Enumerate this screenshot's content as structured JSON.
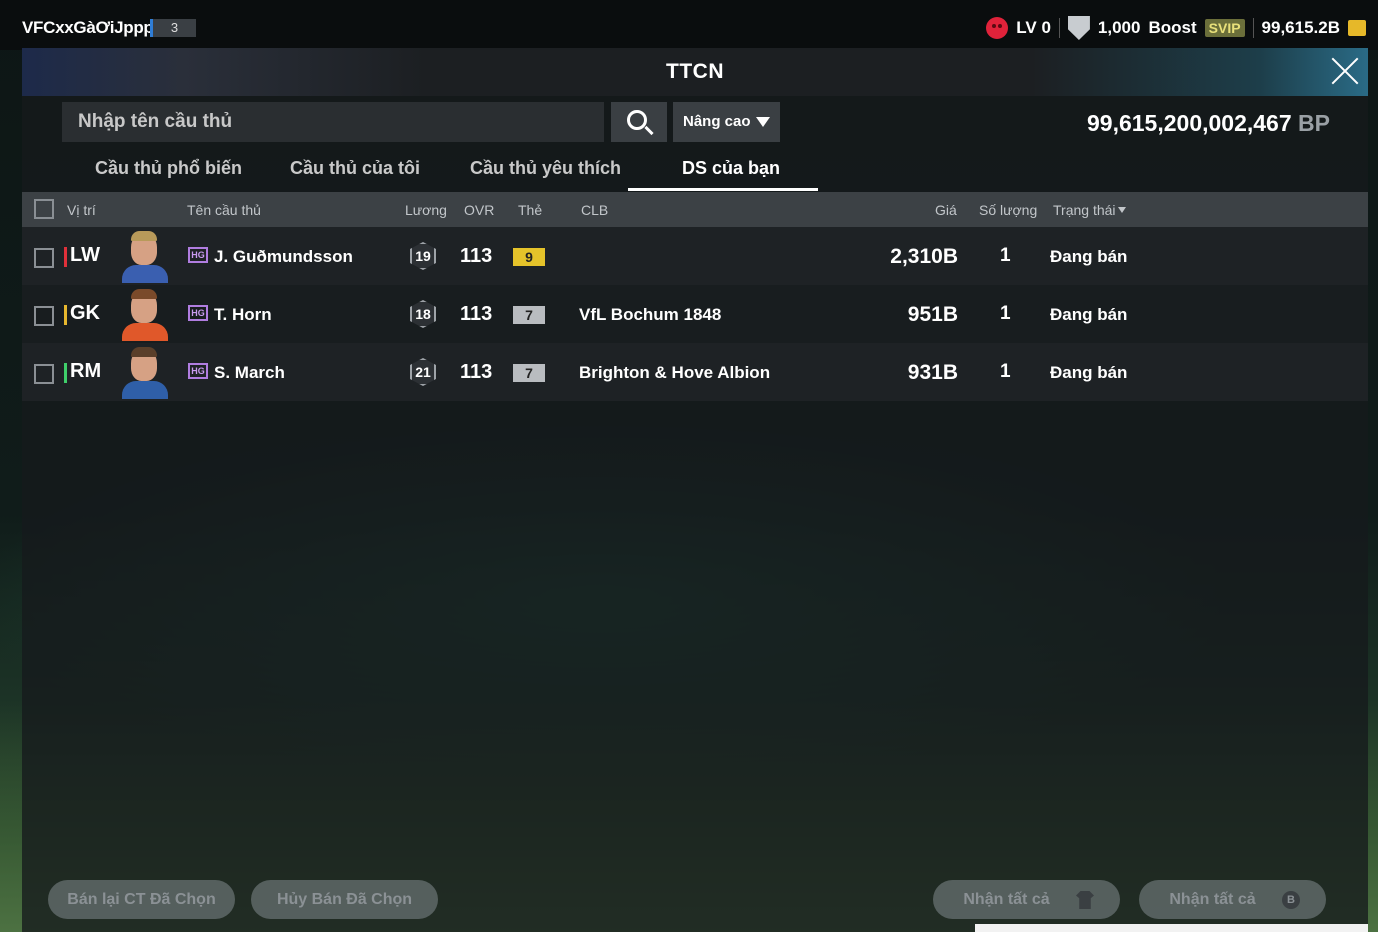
{
  "topbar": {
    "username": "VFCxxGàƠiJpppp",
    "user_level": "3",
    "lv_label": "LV 0",
    "shield_value": "1,000",
    "boost_label": "Boost",
    "svip_label": "SVIP",
    "coins": "99,615.2B"
  },
  "panel": {
    "title": "TTCN",
    "search_placeholder": "Nhập tên cầu thủ",
    "advanced_label": "Nâng cao",
    "bp_total": "99,615,200,002,467",
    "bp_unit": " BP"
  },
  "tabs": [
    {
      "label": "Cầu thủ phổ biến"
    },
    {
      "label": "Cầu thủ của tôi"
    },
    {
      "label": "Cầu thủ yêu thích"
    },
    {
      "label": "DS của bạn"
    }
  ],
  "columns": {
    "position": "Vị trí",
    "name": "Tên cầu thủ",
    "salary": "Lương",
    "ovr": "OVR",
    "card": "Thẻ",
    "club": "CLB",
    "price": "Giá",
    "quantity": "Số lượng",
    "status": "Trạng thái"
  },
  "rows": [
    {
      "position": "LW",
      "pos_color": "#e0303a",
      "badge": "HG",
      "name": "J. Guðmundsson",
      "salary": "19",
      "ovr": "113",
      "card": "9",
      "card_color": "#e5c32a",
      "club": "",
      "price": "2,310B",
      "quantity": "1",
      "status": "Đang bán"
    },
    {
      "position": "GK",
      "pos_color": "#e6b72e",
      "badge": "HG",
      "name": "T. Horn",
      "salary": "18",
      "ovr": "113",
      "card": "7",
      "card_color": "#b9bcc0",
      "club": "VfL Bochum 1848",
      "price": "951B",
      "quantity": "1",
      "status": "Đang bán"
    },
    {
      "position": "RM",
      "pos_color": "#3fcf6a",
      "badge": "HG",
      "name": "S. March",
      "salary": "21",
      "ovr": "113",
      "card": "7",
      "card_color": "#b9bcc0",
      "club": "Brighton & Hove Albion",
      "price": "931B",
      "quantity": "1",
      "status": "Đang bán"
    }
  ],
  "footer": {
    "resell_label": "Bán lại CT Đã Chọn",
    "cancel_label": "Hủy Bán Đã Chọn",
    "collect_all_label_1": "Nhận tất cả",
    "collect_all_label_2": "Nhận tất cả",
    "bp_icon_letter": "B"
  }
}
